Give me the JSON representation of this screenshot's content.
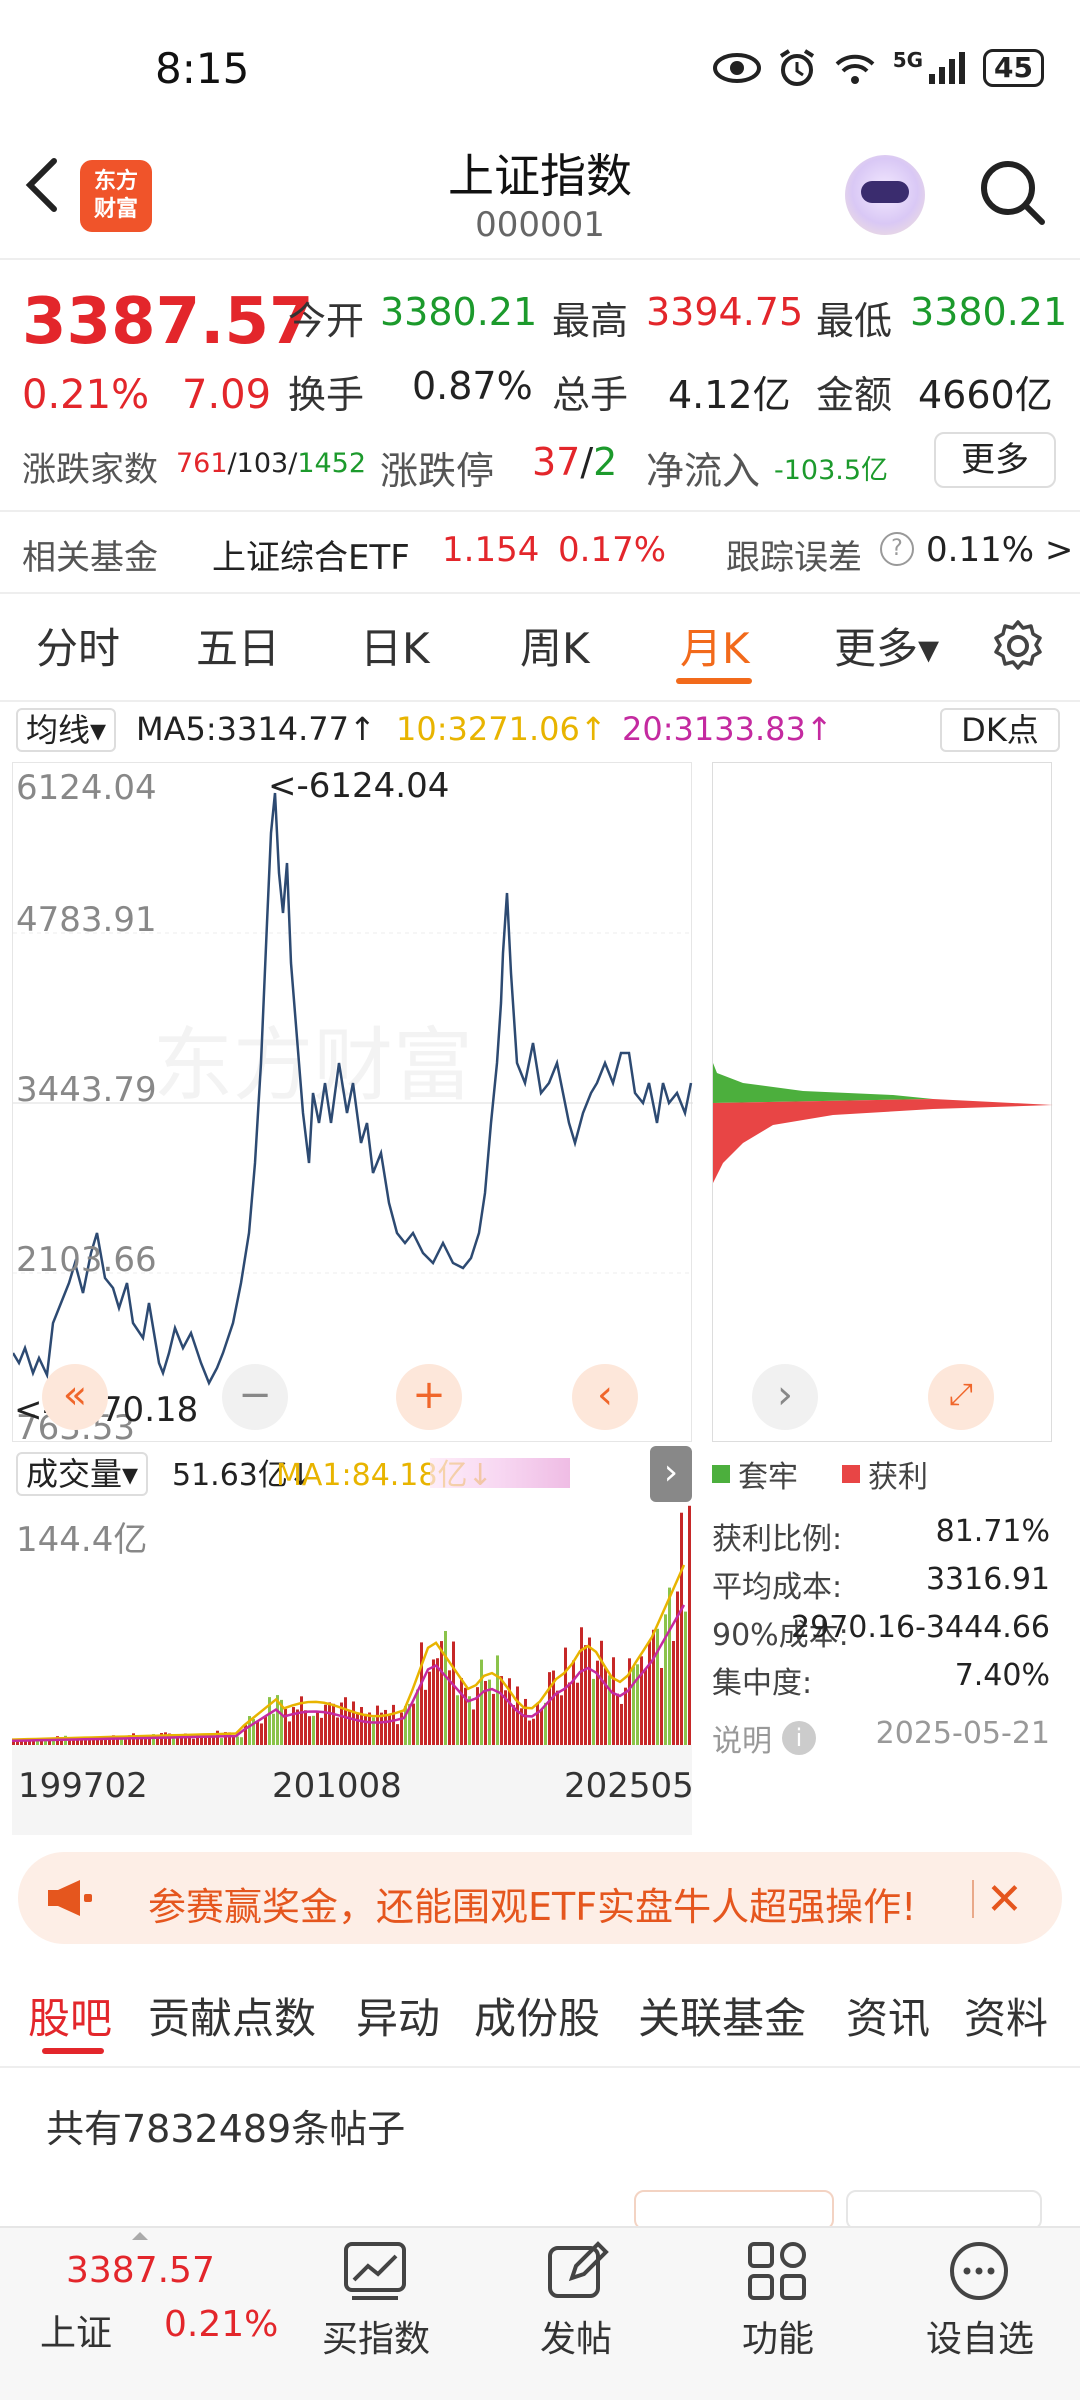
{
  "status_bar": {
    "time": "8:15",
    "network": "5G",
    "battery": "45"
  },
  "header": {
    "logo_text": "东方财富",
    "title": "上证指数",
    "code": "000001"
  },
  "quote": {
    "price": "3387.57",
    "change_pct": "0.21%",
    "change": "7.09",
    "open_label": "今开",
    "open": "3380.21",
    "high_label": "最高",
    "high": "3394.75",
    "low_label": "最低",
    "low": "3380.21",
    "turnover_label": "换手",
    "turnover": "0.87%",
    "volume_label": "总手",
    "volume": "4.12亿",
    "amount_label": "金额",
    "amount": "4660亿",
    "breadth_label": "涨跌家数",
    "breadth_up": "761",
    "breadth_flat": "103",
    "breadth_down": "1452",
    "limit_label": "涨跌停",
    "limit_up": "37",
    "limit_down": "2",
    "netflow_label": "净流入",
    "netflow": "-103.5亿",
    "more_button": "更多",
    "fund_label": "相关基金",
    "fund_name": "上证综合ETF",
    "fund_price": "1.154",
    "fund_pct": "0.17%",
    "tracking_label": "跟踪误差",
    "tracking_value": "0.11% >"
  },
  "period_tabs": [
    {
      "label": "分时"
    },
    {
      "label": "五日"
    },
    {
      "label": "日K"
    },
    {
      "label": "周K"
    },
    {
      "label": "月K",
      "active": true
    },
    {
      "label": "更多▾"
    }
  ],
  "ma_bar": {
    "selector": "均线▾",
    "ma5": "MA5:3314.77↑",
    "ma10": "10:3271.06↑",
    "ma20": "20:3133.83↑",
    "dk_button": "DK点"
  },
  "kline": {
    "y_labels": [
      "6124.04",
      "4783.91",
      "3443.79",
      "2103.66",
      "763.53"
    ],
    "max_annotation": "<-6124.04",
    "min_annotation": "<---870.18",
    "line_color": "#2d4a72"
  },
  "volume_panel": {
    "selector": "成交量▾",
    "vol": "51.63亿↓",
    "ma1": "MA1:84.18亿↓",
    "y_label": "144.4亿",
    "x_labels": [
      "199702",
      "201008",
      "202505"
    ]
  },
  "chip_panel": {
    "legend_trapped": "套牢",
    "legend_profit": "获利",
    "profit_ratio_label": "获利比例:",
    "profit_ratio": "81.71%",
    "avg_cost_label": "平均成本:",
    "avg_cost": "3316.91",
    "cost90_label": "90%成本:",
    "cost90": "2970.16-3444.66",
    "concentration_label": "集中度:",
    "concentration": "7.40%",
    "note_label": "说明",
    "date": "2025-05-21",
    "green": "#4caf3d",
    "red": "#e84545"
  },
  "banner": {
    "text": "参赛赢奖金，还能围观ETF实盘牛人超强操作!"
  },
  "section_tabs": [
    {
      "label": "股吧",
      "active": true
    },
    {
      "label": "贡献点数"
    },
    {
      "label": "异动"
    },
    {
      "label": "成份股"
    },
    {
      "label": "关联基金"
    },
    {
      "label": "资讯"
    },
    {
      "label": "资料"
    }
  ],
  "post_count": "共有7832489条帖子",
  "bottom_nav": {
    "index_price": "3387.57",
    "index_name": "上证",
    "index_pct": "0.21%",
    "items": [
      {
        "label": "买指数",
        "icon": "chart-icon"
      },
      {
        "label": "发帖",
        "icon": "edit-icon"
      },
      {
        "label": "功能",
        "icon": "grid-icon"
      },
      {
        "label": "设自选",
        "icon": "more-icon"
      }
    ]
  }
}
